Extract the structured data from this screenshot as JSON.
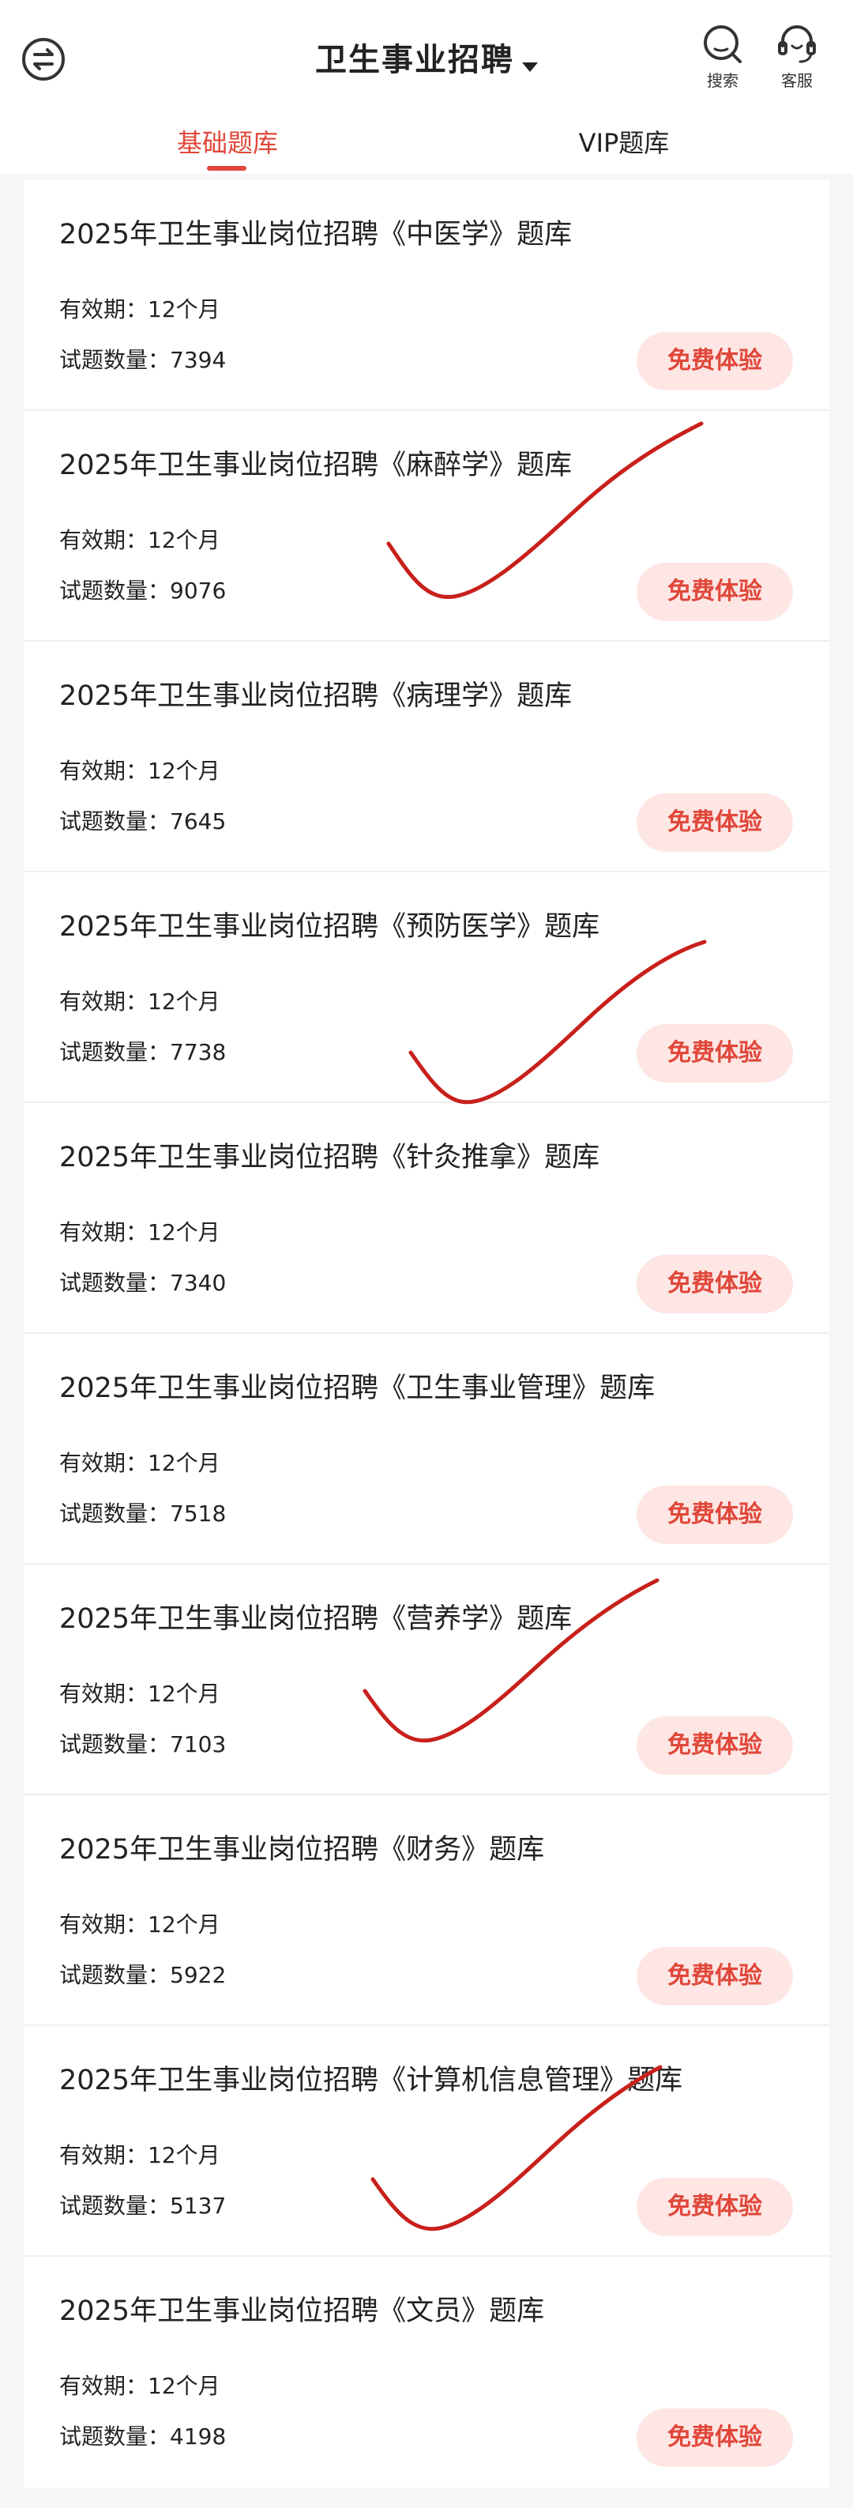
{
  "header": {
    "title": "卫生事业招聘",
    "search_label": "搜索",
    "service_label": "客服",
    "icons": {
      "switch": "switch-arrows-icon",
      "caret": "caret-down-icon",
      "search": "search-icon",
      "service": "headset-icon"
    }
  },
  "tabs": [
    {
      "label": "基础题库",
      "active": true
    },
    {
      "label": "VIP题库",
      "active": false
    }
  ],
  "colors": {
    "accent": "#e0473a",
    "button_bg": "#fde6e4",
    "check_mark": "#c8201b"
  },
  "items": [
    {
      "title": "2025年卫生事业岗位招聘《中医学》题库",
      "validity": "有效期：12个月",
      "count": "试题数量：7394",
      "button": "免费体验"
    },
    {
      "title": "2025年卫生事业岗位招聘《麻醉学》题库",
      "validity": "有效期：12个月",
      "count": "试题数量：9076",
      "button": "免费体验"
    },
    {
      "title": "2025年卫生事业岗位招聘《病理学》题库",
      "validity": "有效期：12个月",
      "count": "试题数量：7645",
      "button": "免费体验"
    },
    {
      "title": "2025年卫生事业岗位招聘《预防医学》题库",
      "validity": "有效期：12个月",
      "count": "试题数量：7738",
      "button": "免费体验"
    },
    {
      "title": "2025年卫生事业岗位招聘《针灸推拿》题库",
      "validity": "有效期：12个月",
      "count": "试题数量：7340",
      "button": "免费体验"
    },
    {
      "title": "2025年卫生事业岗位招聘《卫生事业管理》题库",
      "validity": "有效期：12个月",
      "count": "试题数量：7518",
      "button": "免费体验"
    },
    {
      "title": "2025年卫生事业岗位招聘《营养学》题库",
      "validity": "有效期：12个月",
      "count": "试题数量：7103",
      "button": "免费体验"
    },
    {
      "title": "2025年卫生事业岗位招聘《财务》题库",
      "validity": "有效期：12个月",
      "count": "试题数量：5922",
      "button": "免费体验"
    },
    {
      "title": "2025年卫生事业岗位招聘《计算机信息管理》题库",
      "validity": "有效期：12个月",
      "count": "试题数量：5137",
      "button": "免费体验"
    },
    {
      "title": "2025年卫生事业岗位招聘《文员》题库",
      "validity": "有效期：12个月",
      "count": "试题数量：4198",
      "button": "免费体验"
    }
  ]
}
